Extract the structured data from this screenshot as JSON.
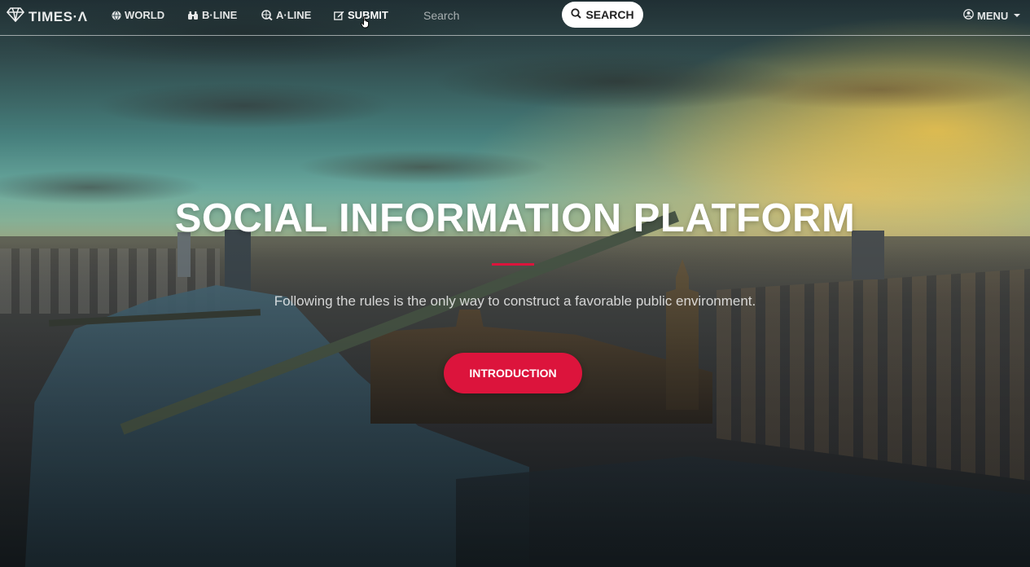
{
  "brand": {
    "name": "TIMES·Λ",
    "icon": "diamond-icon"
  },
  "nav": {
    "items": [
      {
        "label": "WORLD",
        "icon": "globe-icon"
      },
      {
        "label": "B·LINE",
        "icon": "binoculars-icon"
      },
      {
        "label": "A·LINE",
        "icon": "globe-search-icon"
      },
      {
        "label": "SUBMIT",
        "icon": "edit-icon"
      }
    ],
    "search_placeholder": "Search",
    "search_button": "SEARCH",
    "menu_label": "MENU"
  },
  "hero": {
    "title": "SOCIAL INFORMATION PLATFORM",
    "subtitle": "Following the rules is the only way to construct a favorable public environment.",
    "cta_label": "INTRODUCTION",
    "accent_color": "#dc143c"
  }
}
